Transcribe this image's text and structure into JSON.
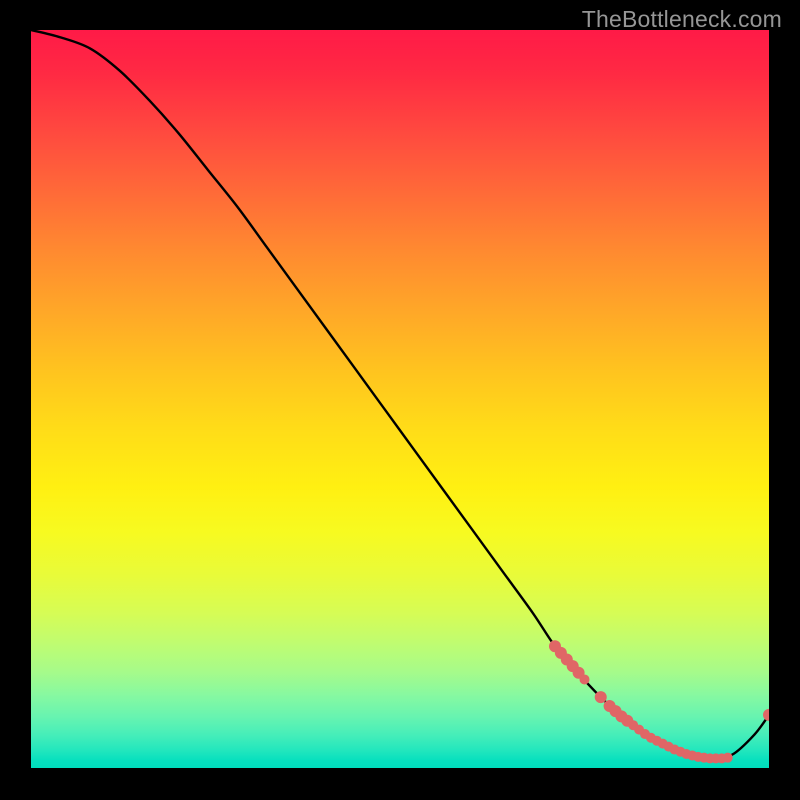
{
  "watermark": "TheBottleneck.com",
  "chart_data": {
    "type": "line",
    "title": "",
    "xlabel": "",
    "ylabel": "",
    "xlim": [
      0,
      100
    ],
    "ylim": [
      0,
      100
    ],
    "background_gradient": {
      "top_color": "#ff1a47",
      "bottom_color": "#00ddbd",
      "note": "red-yellow-green vertical gradient signifying bottleneck severity"
    },
    "curve": {
      "name": "bottleneck-curve",
      "color": "#000000",
      "x": [
        0,
        4,
        8,
        12,
        16,
        20,
        24,
        28,
        32,
        36,
        40,
        44,
        48,
        52,
        56,
        60,
        64,
        68,
        71,
        74,
        77,
        80,
        83,
        86,
        89,
        92,
        95,
        98,
        100
      ],
      "y": [
        100,
        99,
        97.5,
        94.5,
        90.5,
        86,
        81,
        76,
        70.5,
        65,
        59.5,
        54,
        48.5,
        43,
        37.5,
        32,
        26.5,
        21,
        16.5,
        13,
        9.8,
        7,
        4.6,
        2.8,
        1.6,
        1.2,
        1.8,
        4.5,
        7.2
      ]
    },
    "markers": {
      "name": "highlight-dots",
      "color": "#e06666",
      "radius_small": 5,
      "radius_large": 7,
      "points": [
        {
          "x": 71.0,
          "y": 16.5,
          "r": 6
        },
        {
          "x": 71.8,
          "y": 15.6,
          "r": 6
        },
        {
          "x": 72.6,
          "y": 14.7,
          "r": 6
        },
        {
          "x": 73.4,
          "y": 13.8,
          "r": 6
        },
        {
          "x": 74.2,
          "y": 12.9,
          "r": 6
        },
        {
          "x": 75.0,
          "y": 12.0,
          "r": 5
        },
        {
          "x": 77.2,
          "y": 9.6,
          "r": 6
        },
        {
          "x": 78.4,
          "y": 8.4,
          "r": 6
        },
        {
          "x": 79.2,
          "y": 7.7,
          "r": 6
        },
        {
          "x": 80.0,
          "y": 7.0,
          "r": 6
        },
        {
          "x": 80.8,
          "y": 6.4,
          "r": 6
        },
        {
          "x": 81.6,
          "y": 5.8,
          "r": 5
        },
        {
          "x": 82.4,
          "y": 5.2,
          "r": 5
        },
        {
          "x": 83.2,
          "y": 4.6,
          "r": 5
        },
        {
          "x": 84.0,
          "y": 4.1,
          "r": 5
        },
        {
          "x": 84.8,
          "y": 3.7,
          "r": 5
        },
        {
          "x": 85.6,
          "y": 3.3,
          "r": 5
        },
        {
          "x": 86.4,
          "y": 2.9,
          "r": 5
        },
        {
          "x": 87.2,
          "y": 2.5,
          "r": 5
        },
        {
          "x": 88.0,
          "y": 2.2,
          "r": 5
        },
        {
          "x": 88.8,
          "y": 1.9,
          "r": 5
        },
        {
          "x": 89.6,
          "y": 1.7,
          "r": 5
        },
        {
          "x": 90.4,
          "y": 1.5,
          "r": 5
        },
        {
          "x": 91.2,
          "y": 1.4,
          "r": 5
        },
        {
          "x": 92.0,
          "y": 1.3,
          "r": 5
        },
        {
          "x": 92.8,
          "y": 1.3,
          "r": 5
        },
        {
          "x": 93.6,
          "y": 1.3,
          "r": 5
        },
        {
          "x": 94.4,
          "y": 1.4,
          "r": 5
        },
        {
          "x": 100.0,
          "y": 7.2,
          "r": 6
        }
      ]
    }
  }
}
